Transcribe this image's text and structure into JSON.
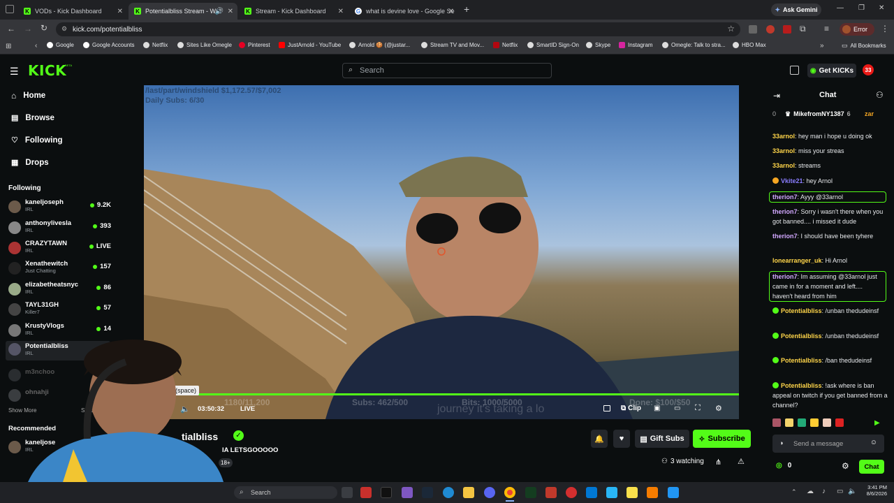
{
  "browser": {
    "tabs": [
      {
        "label": "VODs - Kick Dashboard",
        "active": false
      },
      {
        "label": "Potentialbliss Stream - Wat",
        "active": true
      },
      {
        "label": "Stream - Kick Dashboard",
        "active": false
      },
      {
        "label": "what is devine love - Google Se",
        "active": false
      }
    ],
    "ask_gemini": "Ask Gemini",
    "url": "kick.com/potentialbliss",
    "profile_status": "Error",
    "bookmarks": [
      "Google",
      "Google Accounts",
      "Netflix",
      "Sites Like Omegle",
      "Pinterest",
      "JustArnold - YouTube",
      "Arnold 🍪 (@justar...",
      "Stream TV and Mov...",
      "Netflix",
      "SmartID Sign-On",
      "Skype",
      "Instagram",
      "Omegle: Talk to stra...",
      "HBO Max"
    ],
    "all_bookmarks": "All Bookmarks"
  },
  "kick": {
    "logo": "KICK",
    "logo_badge": "BETA",
    "search_placeholder": "Search",
    "get_kicks": "Get KICKs",
    "notif_count": "33",
    "nav": [
      {
        "label": "Home",
        "icon": "home-icon"
      },
      {
        "label": "Browse",
        "icon": "browse-icon"
      },
      {
        "label": "Following",
        "icon": "heart-icon"
      },
      {
        "label": "Drops",
        "icon": "drops-icon"
      }
    ],
    "following_title": "Following",
    "following": [
      {
        "name": "kaneljoseph",
        "cat": "IRL",
        "viewers": "9.2K"
      },
      {
        "name": "anthonylivesla",
        "cat": "IRL",
        "viewers": "393"
      },
      {
        "name": "CRAZYTAWN",
        "cat": "IRL",
        "viewers": "LIVE"
      },
      {
        "name": "Xenathewitch",
        "cat": "Just Chatting",
        "viewers": "157"
      },
      {
        "name": "elizabetheatsnyc",
        "cat": "IRL",
        "viewers": "86"
      },
      {
        "name": "TAYL31GH",
        "cat": "Killer7",
        "viewers": "57"
      },
      {
        "name": "KrustyVlogs",
        "cat": "IRL",
        "viewers": "14"
      },
      {
        "name": "Potentialbliss",
        "cat": "IRL",
        "viewers": ""
      }
    ],
    "offline": [
      "m3nchoo",
      "ohnahji"
    ],
    "show_more": "Show More",
    "show_less": "Show",
    "recommended_title": "Recommended",
    "recommended": [
      {
        "name": "kaneljose",
        "cat": "IRL"
      }
    ]
  },
  "player": {
    "overlay_top": "/last/part/windshield $1,172.57/$7,002",
    "overlay_sub": "Daily Subs: 6/30",
    "tooltip": "y (space)",
    "time": "03:50:32",
    "live": "LIVE",
    "clip": "Clip",
    "goal_left": "1180/11,200",
    "goal_subs": "Subs: 462/500",
    "goal_bits": "Bits: 1000/5000",
    "goal_done": "Done: $100/$50",
    "ticker": "journey it's taking a lo"
  },
  "channel": {
    "name": "Potentialbliss",
    "name_visible": "tialbliss",
    "title": "IA LETSGOOOOO",
    "badge": "18+",
    "gift_subs": "Gift Subs",
    "subscribe": "Subscribe",
    "watching": "3 watching"
  },
  "chat": {
    "title": "Chat",
    "top_count": "0",
    "top_user": "MikefromNY1387",
    "top_user_count": "6",
    "top_user2": "zar",
    "messages": [
      {
        "user": "33arnol",
        "text": "hey man i hope u doing ok",
        "color": "#ffd54a"
      },
      {
        "user": "33arnol",
        "text": "miss your streas",
        "color": "#ffd54a"
      },
      {
        "user": "33arnol",
        "text": "streams",
        "color": "#ffd54a"
      },
      {
        "user": "Vkite21",
        "text": "hey Arnol",
        "color": "#8a7dff"
      },
      {
        "user": "therion7",
        "text": "Ayyy @33arnol",
        "color": "#d2a8ff"
      },
      {
        "user": "therion7",
        "text": "Sorry i wasn't there when you got banned.... i missed it dude",
        "color": "#d2a8ff"
      },
      {
        "user": "therion7",
        "text": "I should have been tyhere",
        "color": "#d2a8ff"
      },
      {
        "user": "lonearranger_uk",
        "text": "Hi Arnol",
        "color": "#ffd54a"
      },
      {
        "user": "therion7",
        "text": "Im assuming @33arnol just came in for a moment and left.... haven't heard from him",
        "color": "#d2a8ff"
      },
      {
        "user": "Potentialbliss",
        "text": "/unban thedudeinsf",
        "color": "#ffd54a"
      },
      {
        "user": "Potentialbliss",
        "text": "/unban thedudeinsf",
        "color": "#ffd54a"
      },
      {
        "user": "Potentialbliss",
        "text": "/ban thedudeinsf",
        "color": "#ffd54a"
      },
      {
        "user": "Potentialbliss",
        "text": "!ask where is ban appeal on twitch if you get banned from a channel?",
        "color": "#ffd54a"
      }
    ],
    "send_placeholder": "Send a message",
    "points": "0",
    "chat_button": "Chat"
  },
  "taskbar": {
    "search": "Search",
    "time": "3:41 PM",
    "date": "8/6/2026"
  },
  "colors": {
    "accent": "#53fc18",
    "bg": "#0b0e0f"
  }
}
